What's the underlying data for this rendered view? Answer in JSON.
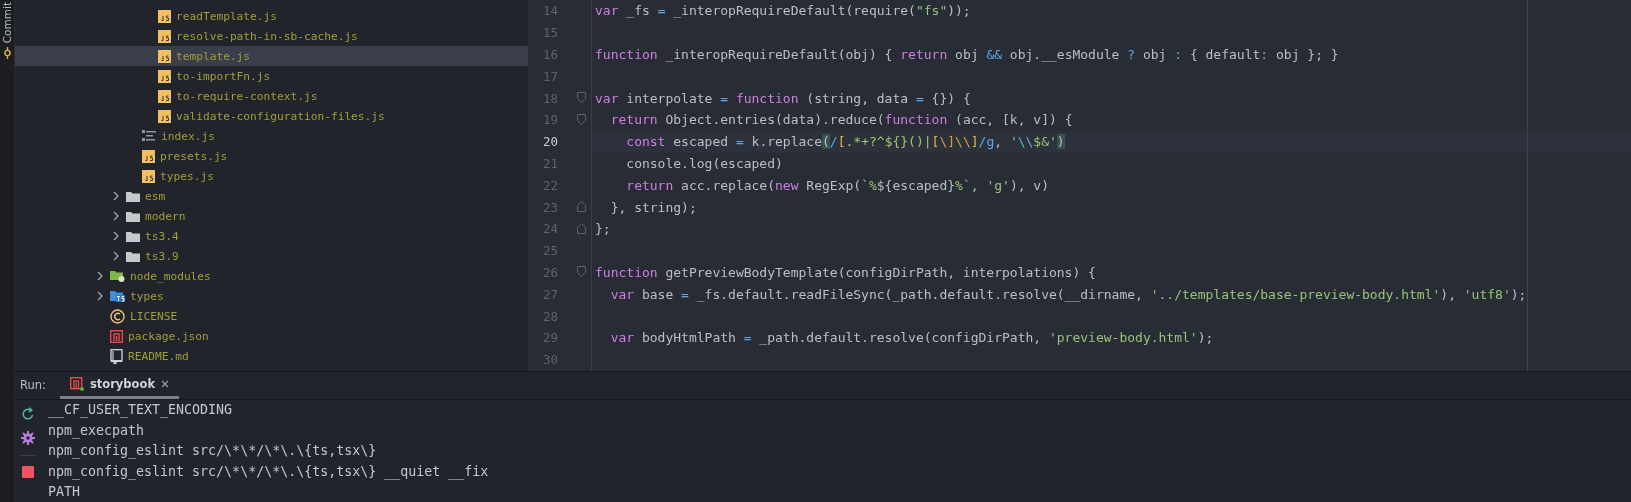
{
  "side_strip": {
    "label": "Commit"
  },
  "project_tree": [
    {
      "children": [
        {
          "children": [
            {
              "children": [
                {
                  "label": "readTemplate.js",
                  "kind": "js",
                  "selected": false
                },
                {
                  "label": "resolve-path-in-sb-cache.js",
                  "kind": "js",
                  "selected": false
                },
                {
                  "label": "template.js",
                  "kind": "js",
                  "selected": true
                },
                {
                  "label": "to-importFn.js",
                  "kind": "js",
                  "selected": false
                },
                {
                  "label": "to-require-context.js",
                  "kind": "js",
                  "selected": false
                },
                {
                  "label": "validate-configuration-files.js",
                  "kind": "js",
                  "selected": false
                }
              ]
            },
            {
              "label": "index.js",
              "kind": "index",
              "selected": false
            },
            {
              "label": "presets.js",
              "kind": "js",
              "selected": false
            },
            {
              "label": "types.js",
              "kind": "js",
              "selected": false
            }
          ]
        },
        {
          "label": "esm",
          "kind": "folder",
          "expanded": false,
          "selected": false
        },
        {
          "label": "modern",
          "kind": "folder",
          "expanded": false,
          "selected": false
        },
        {
          "label": "ts3.4",
          "kind": "folder",
          "expanded": false,
          "selected": false
        },
        {
          "label": "ts3.9",
          "kind": "folder",
          "expanded": false,
          "selected": false
        }
      ]
    },
    {
      "label": "node_modules",
      "kind": "node-folder",
      "expanded": false,
      "selected": false
    },
    {
      "label": "types",
      "kind": "ts-folder",
      "expanded": false,
      "selected": false
    },
    {
      "label": "LICENSE",
      "kind": "license",
      "selected": false
    },
    {
      "label": "package.json",
      "kind": "npm",
      "selected": false
    },
    {
      "label": "README.md",
      "kind": "readme",
      "selected": false
    }
  ],
  "editor": {
    "lines": [
      {
        "number": "14",
        "tokens": [
          {
            "kind": "kw",
            "text": "var"
          },
          {
            "kind": "p",
            "text": " _fs "
          },
          {
            "kind": "op",
            "text": "="
          },
          {
            "kind": "p",
            "text": " _interopRequireDefault(require("
          },
          {
            "kind": "str",
            "text": "\"fs\""
          },
          {
            "kind": "p",
            "text": "));"
          }
        ]
      },
      {
        "number": "15"
      },
      {
        "number": "16",
        "tokens": [
          {
            "kind": "kw",
            "text": "function"
          },
          {
            "kind": "p",
            "text": " _interopRequireDefault(obj) { "
          },
          {
            "kind": "kw",
            "text": "return"
          },
          {
            "kind": "p",
            "text": " obj "
          },
          {
            "kind": "op",
            "text": "&&"
          },
          {
            "kind": "p",
            "text": " obj.__esModule "
          },
          {
            "kind": "op",
            "text": "?"
          },
          {
            "kind": "p",
            "text": " obj "
          },
          {
            "kind": "op",
            "text": ":"
          },
          {
            "kind": "p",
            "text": " { default"
          },
          {
            "kind": "op",
            "text": ":"
          },
          {
            "kind": "p",
            "text": " obj }; }"
          }
        ]
      },
      {
        "number": "17"
      },
      {
        "number": "18",
        "fold_open": true,
        "tokens": [
          {
            "kind": "kw",
            "text": "var"
          },
          {
            "kind": "p",
            "text": " interpolate "
          },
          {
            "kind": "op",
            "text": "="
          },
          {
            "kind": "kw",
            "text": " function"
          },
          {
            "kind": "p",
            "text": " (string, data "
          },
          {
            "kind": "op",
            "text": "="
          },
          {
            "kind": "p",
            "text": " {}) {"
          }
        ]
      },
      {
        "number": "19",
        "fold_open": true,
        "tokens": [
          {
            "kind": "kw",
            "text": "  return"
          },
          {
            "kind": "p",
            "text": " Object.entries(data).reduce("
          },
          {
            "kind": "kw",
            "text": "function"
          },
          {
            "kind": "p",
            "text": " (acc, [k, v]) {"
          }
        ]
      },
      {
        "number": "20",
        "current": true,
        "tokens": [
          {
            "kind": "kw",
            "text": "    const"
          },
          {
            "kind": "p",
            "text": " escaped "
          },
          {
            "kind": "op",
            "text": "="
          },
          {
            "kind": "p",
            "text": " k.replace"
          },
          {
            "kind": "match",
            "text": "("
          },
          {
            "kind": "rxd",
            "text": "/"
          },
          {
            "kind": "rb",
            "text": "["
          },
          {
            "kind": "rx",
            "text": ".*+?^${}()|"
          },
          {
            "kind": "rb",
            "text": "["
          },
          {
            "kind": "esc",
            "text": "\\]"
          },
          {
            "kind": "esc",
            "text": "\\\\"
          },
          {
            "kind": "rb",
            "text": "]"
          },
          {
            "kind": "rxd",
            "text": "/g"
          },
          {
            "kind": "p",
            "text": ", "
          },
          {
            "kind": "str",
            "text": "'"
          },
          {
            "kind": "esc2",
            "text": "\\\\"
          },
          {
            "kind": "str",
            "text": "$&'"
          },
          {
            "kind": "match",
            "text": ")"
          }
        ]
      },
      {
        "number": "21",
        "tokens": [
          {
            "kind": "p",
            "text": "    console.log(escaped)"
          }
        ]
      },
      {
        "number": "22",
        "tokens": [
          {
            "kind": "kw",
            "text": "    return"
          },
          {
            "kind": "p",
            "text": " acc.replace("
          },
          {
            "kind": "kw",
            "text": "new"
          },
          {
            "kind": "p",
            "text": " RegExp("
          },
          {
            "kind": "str",
            "text": "`%"
          },
          {
            "kind": "p",
            "text": "${escaped}"
          },
          {
            "kind": "str",
            "text": "%`"
          },
          {
            "kind": "p",
            "text": ", "
          },
          {
            "kind": "str",
            "text": "'g'"
          },
          {
            "kind": "p",
            "text": "), v)"
          }
        ]
      },
      {
        "number": "23",
        "fold_close": true,
        "tokens": [
          {
            "kind": "p",
            "text": "  }, string);"
          }
        ]
      },
      {
        "number": "24",
        "fold_close": true,
        "tokens": [
          {
            "kind": "p",
            "text": "};"
          }
        ]
      },
      {
        "number": "25"
      },
      {
        "number": "26",
        "fold_open": true,
        "tokens": [
          {
            "kind": "kw",
            "text": "function"
          },
          {
            "kind": "p",
            "text": " getPreviewBodyTemplate(configDirPath, interpolations) {"
          }
        ]
      },
      {
        "number": "27",
        "tokens": [
          {
            "kind": "kw",
            "text": "  var"
          },
          {
            "kind": "p",
            "text": " base "
          },
          {
            "kind": "op",
            "text": "="
          },
          {
            "kind": "p",
            "text": " _fs.default.readFileSync(_path.default.resolve(__dirname, "
          },
          {
            "kind": "str",
            "text": "'../templates/base-preview-body.html'"
          },
          {
            "kind": "p",
            "text": "), "
          },
          {
            "kind": "str",
            "text": "'utf8'"
          },
          {
            "kind": "p",
            "text": ");"
          }
        ]
      },
      {
        "number": "28"
      },
      {
        "number": "29",
        "tokens": [
          {
            "kind": "kw",
            "text": "  var"
          },
          {
            "kind": "p",
            "text": " bodyHtmlPath "
          },
          {
            "kind": "op",
            "text": "="
          },
          {
            "kind": "p",
            "text": " _path.default.resolve(configDirPath, "
          },
          {
            "kind": "str",
            "text": "'preview-body.html'"
          },
          {
            "kind": "p",
            "text": ");"
          }
        ]
      },
      {
        "number": "30"
      }
    ]
  },
  "run_panel": {
    "label": "Run:",
    "tabs": [
      {
        "label": "storybook",
        "selected": true
      }
    ],
    "console_lines": [
      "__CF_USER_TEXT_ENCODING",
      "npm_execpath",
      "npm_config_eslint src/\\*\\*/\\*\\.\\{ts,tsx\\}",
      "npm_config_eslint src/\\*\\*/\\*\\.\\{ts,tsx\\} __quiet __fix",
      "PATH"
    ]
  }
}
